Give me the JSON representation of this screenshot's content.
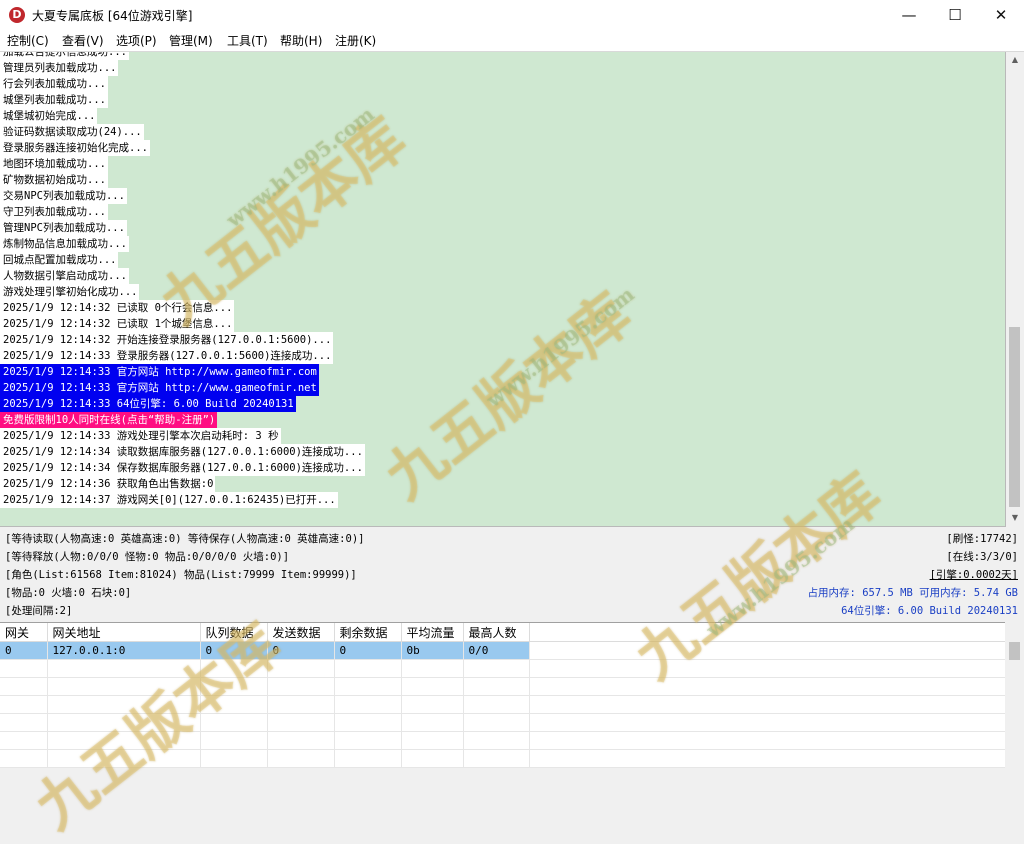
{
  "window": {
    "icon_letter": "D",
    "title": "大夏专属底板 [64位游戏引擎]",
    "controls": {
      "minimize": "—",
      "maximize": "☐",
      "close": "✕"
    }
  },
  "menu": [
    "控制(C)",
    "查看(V)",
    "选项(P)",
    "管理(M)",
    "工具(T)",
    "帮助(H)",
    "注册(K)"
  ],
  "log": {
    "lines": [
      {
        "text": "加载公告提示信息成功...",
        "style": "normal"
      },
      {
        "text": "管理员列表加载成功...",
        "style": "normal"
      },
      {
        "text": "行会列表加载成功...",
        "style": "normal"
      },
      {
        "text": "城堡列表加载成功...",
        "style": "normal"
      },
      {
        "text": "城堡城初始完成...",
        "style": "normal"
      },
      {
        "text": "验证码数据读取成功(24)...",
        "style": "normal"
      },
      {
        "text": "登录服务器连接初始化完成...",
        "style": "normal"
      },
      {
        "text": "地图环境加载成功...",
        "style": "normal"
      },
      {
        "text": "矿物数据初始成功...",
        "style": "normal"
      },
      {
        "text": "交易NPC列表加载成功...",
        "style": "normal"
      },
      {
        "text": "守卫列表加载成功...",
        "style": "normal"
      },
      {
        "text": "管理NPC列表加载成功...",
        "style": "normal"
      },
      {
        "text": "炼制物品信息加载成功...",
        "style": "normal"
      },
      {
        "text": "回城点配置加载成功...",
        "style": "normal"
      },
      {
        "text": "人物数据引擎启动成功...",
        "style": "normal"
      },
      {
        "text": "游戏处理引擎初始化成功...",
        "style": "normal"
      },
      {
        "text": "2025/1/9 12:14:32 已读取 0个行会信息...",
        "style": "normal"
      },
      {
        "text": "2025/1/9 12:14:32 已读取 1个城堡信息...",
        "style": "normal"
      },
      {
        "text": "2025/1/9 12:14:32 开始连接登录服务器(127.0.0.1:5600)...",
        "style": "normal"
      },
      {
        "text": "2025/1/9 12:14:33 登录服务器(127.0.0.1:5600)连接成功...",
        "style": "normal"
      },
      {
        "text": "2025/1/9 12:14:33 官方网站 http://www.gameofmir.com",
        "style": "sel"
      },
      {
        "text": "2025/1/9 12:14:33 官方网站 http://www.gameofmir.net",
        "style": "sel"
      },
      {
        "text": "2025/1/9 12:14:33 64位引擎: 6.00 Build 20240131",
        "style": "sel"
      },
      {
        "text": "免费版限制10人同时在线(点击“帮助-注册”)",
        "style": "warn"
      },
      {
        "text": "2025/1/9 12:14:33 游戏处理引擎本次启动耗时: 3 秒",
        "style": "normal"
      },
      {
        "text": "2025/1/9 12:14:34 读取数据库服务器(127.0.0.1:6000)连接成功...",
        "style": "normal"
      },
      {
        "text": "2025/1/9 12:14:34 保存数据库服务器(127.0.0.1:6000)连接成功...",
        "style": "normal"
      },
      {
        "text": "2025/1/9 12:14:36 获取角色出售数据:0",
        "style": "normal"
      },
      {
        "text": "2025/1/9 12:14:37 游戏网关[0](127.0.0.1:62435)已打开...",
        "style": "normal"
      }
    ]
  },
  "status": {
    "left": [
      "[等待读取(人物高速:0 英雄高速:0) 等待保存(人物高速:0 英雄高速:0)]",
      "[等待释放(人物:0/0/0 怪物:0 物品:0/0/0/0 火墙:0)]",
      "[角色(List:61568 Item:81024) 物品(List:79999 Item:99999)]",
      "[物品:0 火墙:0 石块:0]",
      "[处理间隔:2]"
    ],
    "refresh": "[刷怪:17742]",
    "online": "[在线:3/3/0]",
    "engine_time": "[引擎:0.0002天]",
    "memory": "占用内存: 657.5 MB 可用内存: 5.74 GB",
    "version": "64位引擎: 6.00 Build 20240131"
  },
  "gateway_table": {
    "headers": [
      "网关",
      "网关地址",
      "队列数据",
      "发送数据",
      "剩余数据",
      "平均流量",
      "最高人数"
    ],
    "rows": [
      [
        "0",
        "127.0.0.1:0",
        "0",
        "0",
        "0",
        "0b",
        "0/0"
      ]
    ]
  },
  "watermark": {
    "cn": "九五版本库",
    "url": "www.h1995.com"
  }
}
